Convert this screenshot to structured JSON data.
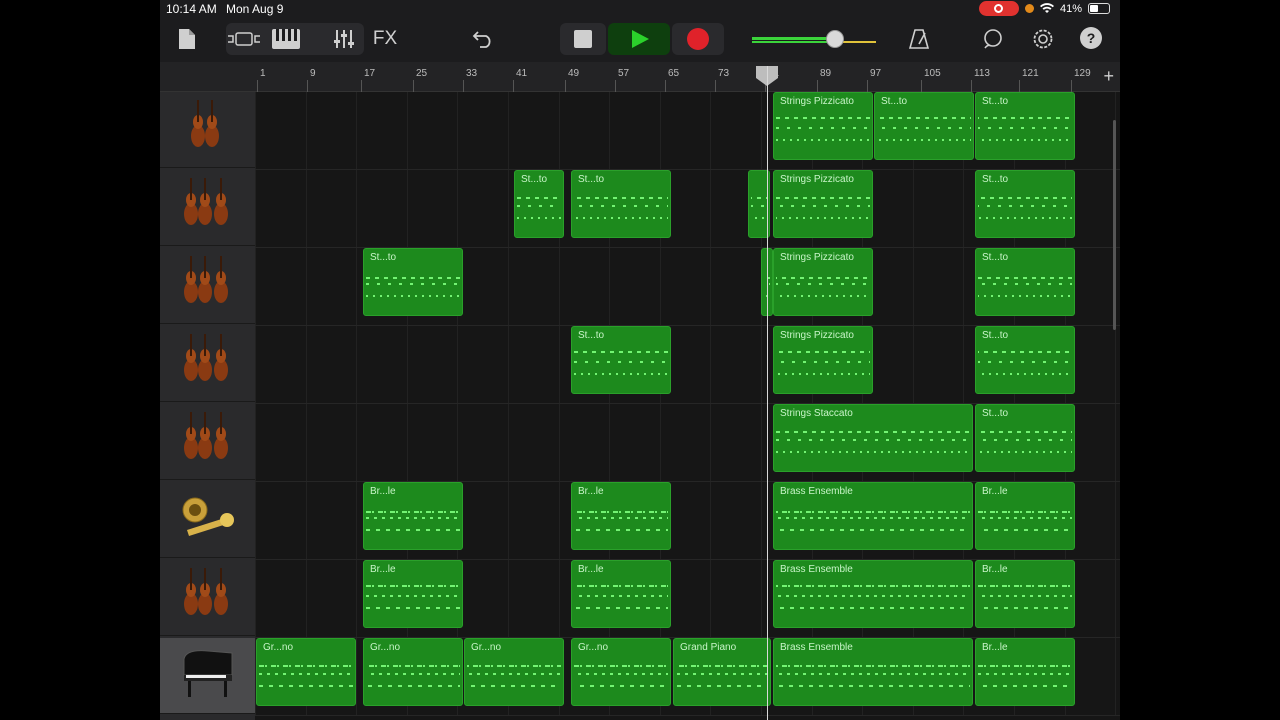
{
  "status": {
    "time": "10:14 AM",
    "date": "Mon Aug 9",
    "battery": "41%"
  },
  "toolbar": {
    "fx_label": "FX",
    "help_label": "?",
    "colors": {
      "play": "#2bd12b",
      "record": "#e0222a"
    }
  },
  "ruler": {
    "ticks": [
      "1",
      "9",
      "17",
      "25",
      "33",
      "41",
      "49",
      "57",
      "65",
      "73",
      "81",
      "89",
      "97",
      "105",
      "113",
      "121",
      "129"
    ]
  },
  "tracks": [
    {
      "instrument": "violin-icon",
      "regions": [
        {
          "label": "Strings Pizzicato"
        },
        {
          "label": "St...to"
        },
        {
          "label": "St...to"
        }
      ]
    },
    {
      "instrument": "strings-icon",
      "regions": [
        {
          "label": "St...to"
        },
        {
          "label": "St...to"
        },
        {
          "label": ""
        },
        {
          "label": "Strings Pizzicato"
        },
        {
          "label": "St...to"
        }
      ]
    },
    {
      "instrument": "strings-icon",
      "regions": [
        {
          "label": "St...to"
        },
        {
          "label": ""
        },
        {
          "label": "Strings Pizzicato"
        },
        {
          "label": "St...to"
        }
      ]
    },
    {
      "instrument": "strings-icon",
      "regions": [
        {
          "label": "St...to"
        },
        {
          "label": "Strings Pizzicato"
        },
        {
          "label": "St...to"
        }
      ]
    },
    {
      "instrument": "strings-icon",
      "regions": [
        {
          "label": "Strings Staccato"
        },
        {
          "label": "St...to"
        }
      ]
    },
    {
      "instrument": "brass-icon",
      "regions": [
        {
          "label": "Br...le"
        },
        {
          "label": "Br...le"
        },
        {
          "label": "Brass Ensemble"
        },
        {
          "label": "Br...le"
        }
      ]
    },
    {
      "instrument": "strings-icon",
      "regions": [
        {
          "label": "Br...le"
        },
        {
          "label": "Br...le"
        },
        {
          "label": "Brass Ensemble"
        },
        {
          "label": "Br...le"
        }
      ]
    },
    {
      "instrument": "piano-icon",
      "regions": [
        {
          "label": "Gr...no"
        },
        {
          "label": "Gr...no"
        },
        {
          "label": "Gr...no"
        },
        {
          "label": "Gr...no"
        },
        {
          "label": "Grand Piano"
        },
        {
          "label": "Brass Ensemble"
        },
        {
          "label": "Br...le"
        }
      ]
    }
  ]
}
